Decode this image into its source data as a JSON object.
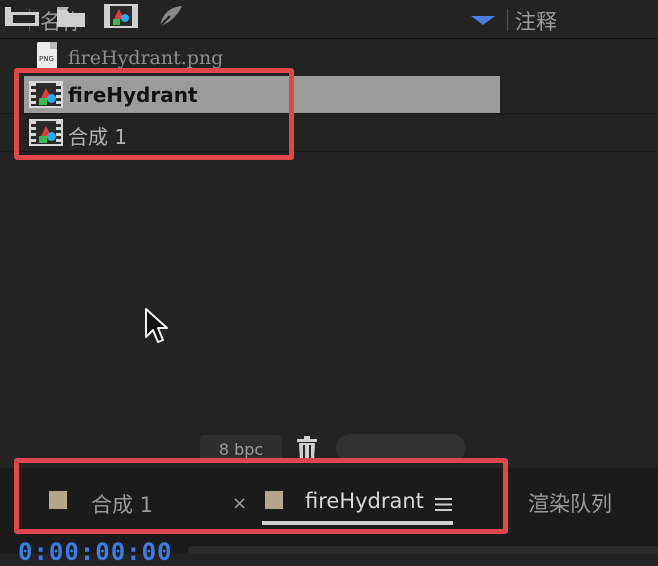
{
  "columns": {
    "name": "名称",
    "comment": "注释"
  },
  "items": [
    {
      "label": "fireHydrant.png",
      "icon": "png-file-icon",
      "selected": false
    },
    {
      "label": "fireHydrant",
      "icon": "composition-icon",
      "selected": true
    },
    {
      "label": "合成 1",
      "icon": "composition-icon",
      "selected": false
    }
  ],
  "toolbar": {
    "bpc": "8 bpc"
  },
  "tabs": [
    {
      "label": "合成 1",
      "swatch": "#b3a68a"
    },
    {
      "label": "fireHydrant",
      "swatch": "#b3a68a",
      "active": true
    }
  ],
  "tab_close": "×",
  "render_queue": "渲染队列",
  "timecode": "0:00:00:00",
  "colors": {
    "highlight": "#e0474b",
    "selection": "#9c9c9c",
    "accent": "#3b7de0"
  }
}
